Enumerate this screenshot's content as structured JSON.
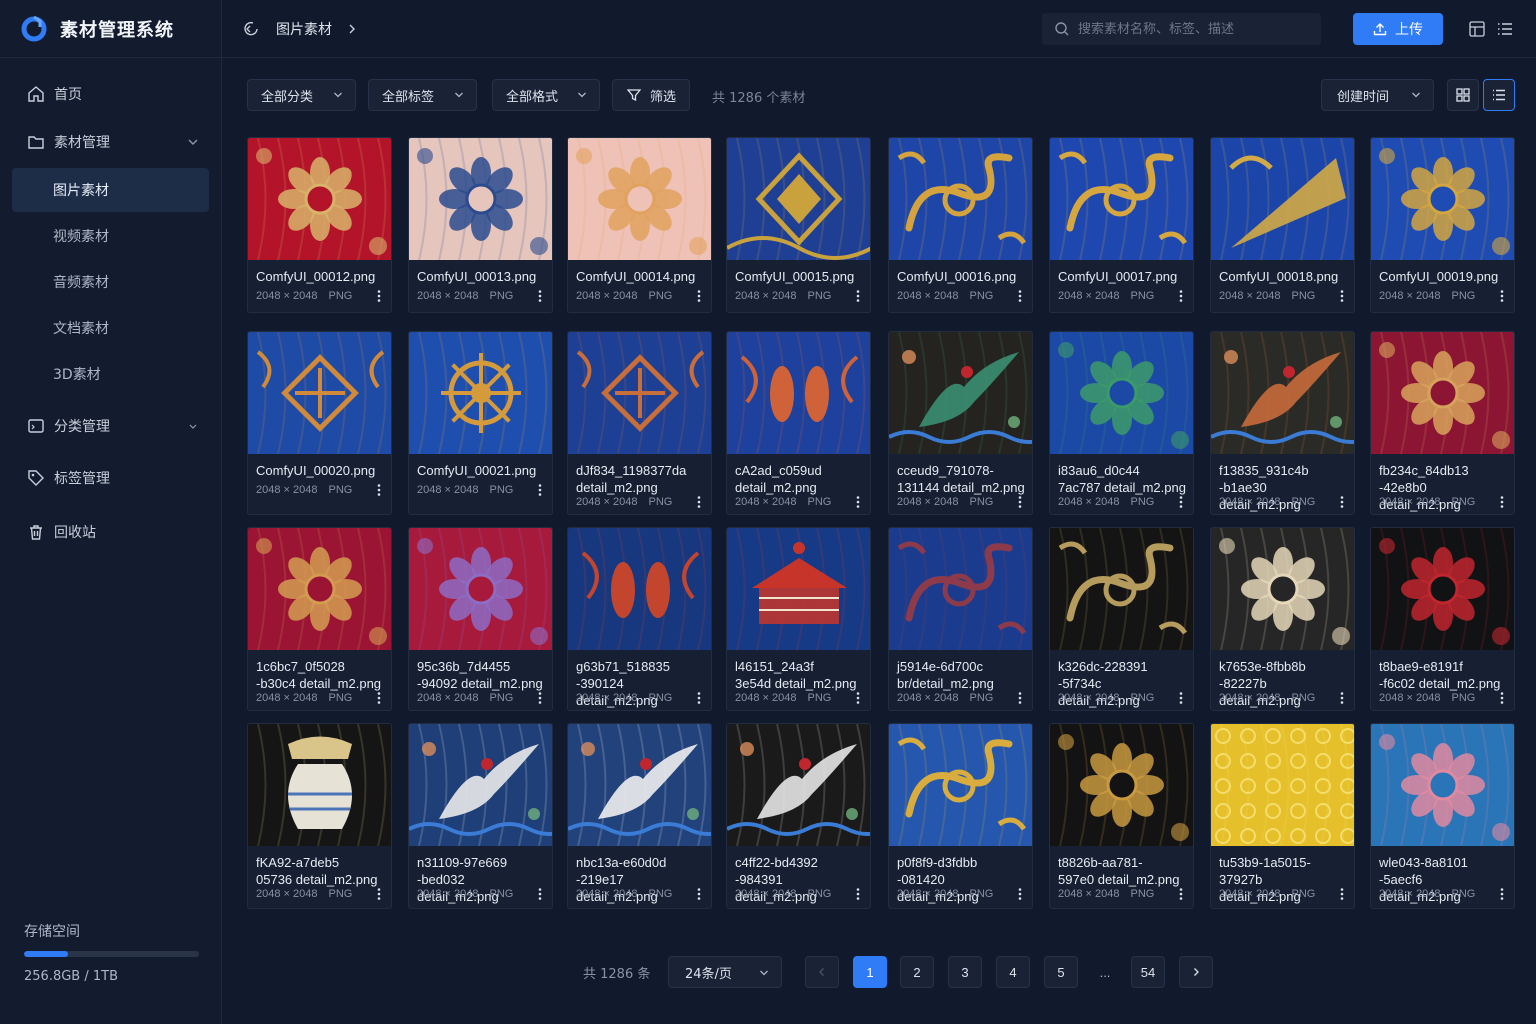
{
  "app": {
    "title": "素材管理系统"
  },
  "sidebar": {
    "items": [
      {
        "label": "首页",
        "icon": "home-icon"
      },
      {
        "label": "素材管理",
        "icon": "folder-icon"
      },
      {
        "label": "分类管理",
        "icon": "category-icon"
      },
      {
        "label": "标签管理",
        "icon": "tag-icon"
      },
      {
        "label": "回收站",
        "icon": "trash-icon"
      }
    ],
    "subitems": [
      {
        "label": "图片素材",
        "active": true
      },
      {
        "label": "视频素材"
      },
      {
        "label": "音频素材"
      },
      {
        "label": "文档素材"
      },
      {
        "label": "3D素材"
      }
    ],
    "storage": {
      "label": "存储空间",
      "used_fraction": 0.25,
      "value": "256.8GB / 1TB"
    }
  },
  "header": {
    "breadcrumb": "图片素材",
    "search_placeholder": "搜索素材名称、标签、描述",
    "upload_label": "上传"
  },
  "filters": {
    "category": "全部分类",
    "tags": "全部标签",
    "format": "全部格式",
    "filter_label": "筛选",
    "count": "共 1286 个素材",
    "sort": "创建时间"
  },
  "colors": {
    "accent": "#2f7cf6",
    "background": "#111a2c",
    "sidebar": "#131c2e",
    "card": "#172033"
  },
  "assets": [
    {
      "name": "ComfyUI_00012.png",
      "dims": "2048 × 2048",
      "format": "PNG",
      "bg": "#b3142a",
      "fg": "#d8b36a",
      "motif": "flower"
    },
    {
      "name": "ComfyUI_00013.png",
      "dims": "2048 × 2048",
      "format": "PNG",
      "bg": "#e5c5bc",
      "fg": "#2c4b8f",
      "motif": "flower"
    },
    {
      "name": "ComfyUI_00014.png",
      "dims": "2048 × 2048",
      "format": "PNG",
      "bg": "#efc2b8",
      "fg": "#e1a25e",
      "motif": "flower"
    },
    {
      "name": "ComfyUI_00015.png",
      "dims": "2048 × 2048",
      "format": "PNG",
      "bg": "#1f3f95",
      "fg": "#c9a23d",
      "motif": "diamond"
    },
    {
      "name": "ComfyUI_00016.png",
      "dims": "2048 × 2048",
      "format": "PNG",
      "bg": "#1e46a8",
      "fg": "#d4a33d",
      "motif": "scroll"
    },
    {
      "name": "ComfyUI_00017.png",
      "dims": "2048 × 2048",
      "format": "PNG",
      "bg": "#1e48b0",
      "fg": "#d6a63f",
      "motif": "scroll"
    },
    {
      "name": "ComfyUI_00018.png",
      "dims": "2048 × 2048",
      "format": "PNG",
      "bg": "#1c45aa",
      "fg": "#d3aa45",
      "motif": "fan"
    },
    {
      "name": "ComfyUI_00019.png",
      "dims": "2048 × 2048",
      "format": "PNG",
      "bg": "#1f4cb2",
      "fg": "#d4a640",
      "motif": "flower"
    },
    {
      "name": "ComfyUI_00020.png",
      "dims": "2048 × 2048",
      "format": "PNG",
      "bg": "#1e4ba6",
      "fg": "#d08a3a",
      "motif": "knot"
    },
    {
      "name": "ComfyUI_00021.png",
      "dims": "2048 × 2048",
      "format": "PNG",
      "bg": "#1f4fae",
      "fg": "#d49a3c",
      "motif": "wheel"
    },
    {
      "name": "dJf834_1198377da\ndetail_m2.png",
      "dims": "2048 × 2048",
      "format": "PNG",
      "bg": "#1d3f94",
      "fg": "#c76e3a",
      "motif": "knot"
    },
    {
      "name": "cA2ad_c059ud\ndetail_m2.png",
      "dims": "2048 × 2048",
      "format": "PNG",
      "bg": "#1d419c",
      "fg": "#d0623a",
      "motif": "fish"
    },
    {
      "name": "cceud9_791078-\n131144 detail_m2.png",
      "dims": "2048 × 2048",
      "format": "PNG",
      "bg": "#24231f",
      "fg": "#3b8f73",
      "motif": "bird"
    },
    {
      "name": "i83au6_d0c44\n7ac787 detail_m2.png",
      "dims": "2048 × 2048",
      "format": "PNG",
      "bg": "#1d49a6",
      "fg": "#3c9a6a",
      "motif": "flower"
    },
    {
      "name": "f13835_931c4b\n-b1ae30 detail_m2.png",
      "dims": "2048 × 2048",
      "format": "PNG",
      "bg": "#2a2b26",
      "fg": "#c66a3c",
      "motif": "bird"
    },
    {
      "name": "fb234c_84db13\n-42e8b0 detail_m2.png",
      "dims": "2048 × 2048",
      "format": "PNG",
      "bg": "#8c1534",
      "fg": "#d7a35c",
      "motif": "flower"
    },
    {
      "name": "1c6bc7_0f5028\n-b30c4 detail_m2.png",
      "dims": "2048 × 2048",
      "format": "PNG",
      "bg": "#9b1434",
      "fg": "#d39c52",
      "motif": "flower"
    },
    {
      "name": "95c36b_7d4455\n-94092 detail_m2.png",
      "dims": "2048 × 2048",
      "format": "PNG",
      "bg": "#a71a3c",
      "fg": "#8e6cc4",
      "motif": "flower"
    },
    {
      "name": "g63b71_518835\n-390124 detail_m2.png",
      "dims": "2048 × 2048",
      "format": "PNG",
      "bg": "#17377f",
      "fg": "#c4452e",
      "motif": "fish"
    },
    {
      "name": "l46151_24a3f\n3e54d detail_m2.png",
      "dims": "2048 × 2048",
      "format": "PNG",
      "bg": "#173a86",
      "fg": "#c7352a",
      "motif": "pavilion"
    },
    {
      "name": "j5914e-6d700c\nbr/detail_m2.png",
      "dims": "2048 × 2048",
      "format": "PNG",
      "bg": "#1b3c8e",
      "fg": "#8d3b4a",
      "motif": "scroll"
    },
    {
      "name": "k326dc-228391\n-5f734c detail_m2.png",
      "dims": "2048 × 2048",
      "format": "PNG",
      "bg": "#141414",
      "fg": "#b59b5c",
      "motif": "scroll"
    },
    {
      "name": "k7653e-8fbb8b\n-82227b detail_m2.png",
      "dims": "2048 × 2048",
      "format": "PNG",
      "bg": "#262626",
      "fg": "#e5d7b8",
      "motif": "flower"
    },
    {
      "name": "t8bae9-e8191f\n-f6c02 detail_m2.png",
      "dims": "2048 × 2048",
      "format": "PNG",
      "bg": "#101214",
      "fg": "#c0262e",
      "motif": "flower"
    },
    {
      "name": "fKA92-a7deb5\n05736 detail_m2.png",
      "dims": "2048 × 2048",
      "format": "PNG",
      "bg": "#151515",
      "fg": "#d9c48a",
      "motif": "vase"
    },
    {
      "name": "n31109-97e669\n-bed032 detail_m2.png",
      "dims": "2048 × 2048",
      "format": "PNG",
      "bg": "#1f3f78",
      "fg": "#e9e9ea",
      "motif": "bird"
    },
    {
      "name": "nbc13a-e60d0d\n-219e17 detail_m2.png",
      "dims": "2048 × 2048",
      "format": "PNG",
      "bg": "#22427c",
      "fg": "#eeeeee",
      "motif": "bird"
    },
    {
      "name": "c4ff22-bd4392\n-984391 detail_m2.png",
      "dims": "2048 × 2048",
      "format": "PNG",
      "bg": "#1a1a1a",
      "fg": "#e5e5e5",
      "motif": "bird"
    },
    {
      "name": "p0f8f9-d3fdbb\n-081420 detail_m2.png",
      "dims": "2048 × 2048",
      "format": "PNG",
      "bg": "#2457ad",
      "fg": "#d8ad3e",
      "motif": "scroll"
    },
    {
      "name": "t8826b-aa781-\n597e0 detail_m2.png",
      "dims": "2048 × 2048",
      "format": "PNG",
      "bg": "#131313",
      "fg": "#c99a40",
      "motif": "flower"
    },
    {
      "name": "tu53b9-1a5015-\n37927b detail_m2.png",
      "dims": "2048 × 2048",
      "format": "PNG",
      "bg": "#e5c02a",
      "fg": "#f4dd6c",
      "motif": "plain"
    },
    {
      "name": "wle043-8a8101\n-5aecf6 detail_m2.png",
      "dims": "2048 × 2048",
      "format": "PNG",
      "bg": "#2a74b8",
      "fg": "#e08aa0",
      "motif": "flower"
    }
  ],
  "pagination": {
    "total": "共 1286 条",
    "page_size": "24条/页",
    "pages": [
      "1",
      "2",
      "3",
      "4",
      "5",
      "...",
      "54"
    ],
    "current": "1"
  }
}
